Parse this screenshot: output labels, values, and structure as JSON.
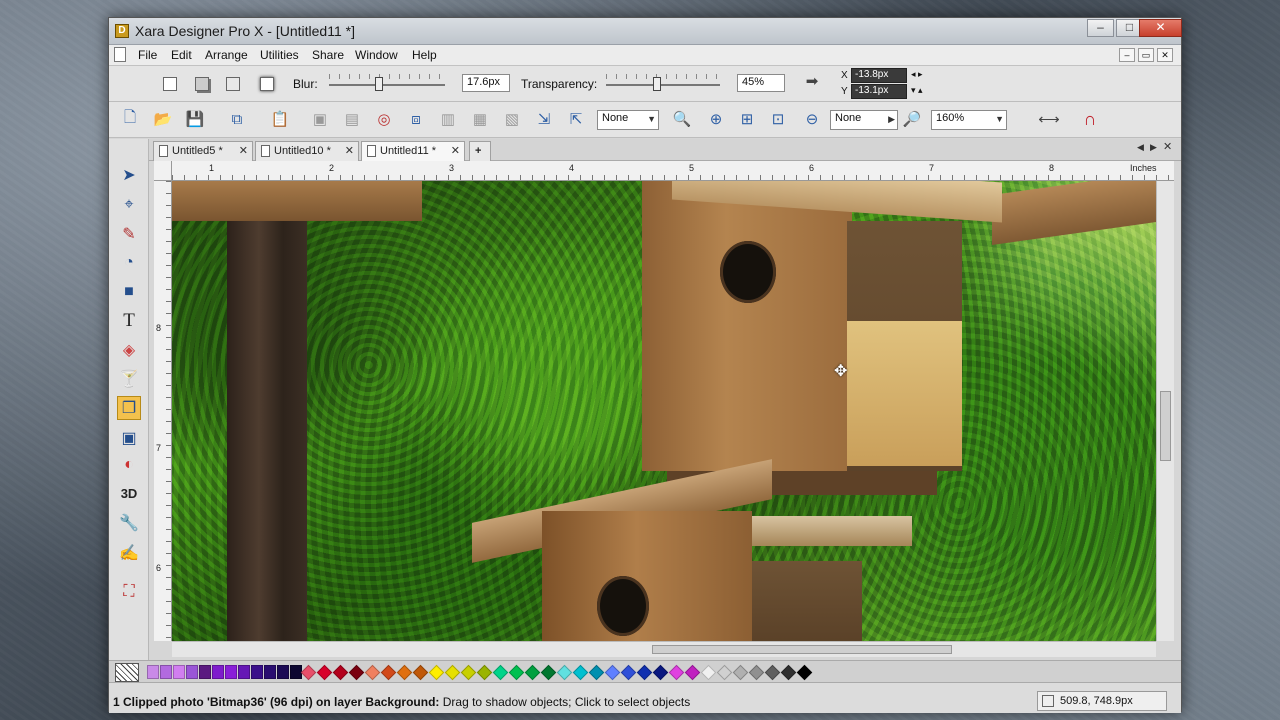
{
  "window": {
    "title": "Xara Designer Pro X - [Untitled11 *]"
  },
  "menu": [
    "File",
    "Edit",
    "Arrange",
    "Utilities",
    "Share",
    "Window",
    "Help"
  ],
  "infobar": {
    "blur_label": "Blur:",
    "blur_value": "17.6px",
    "transparency_label": "Transparency:",
    "transparency_value": "45%",
    "x_label": "X",
    "x_value": "-13.8px",
    "y_label": "Y",
    "y_value": "-13.1px"
  },
  "toolbar": {
    "feather_select": "None",
    "zoom_select": "None",
    "zoom_level": "160%"
  },
  "tabs": [
    {
      "label": "Untitled5 *",
      "active": false
    },
    {
      "label": "Untitled10 *",
      "active": false
    },
    {
      "label": "Untitled11 *",
      "active": true
    }
  ],
  "ruler": {
    "top_labels": [
      "1",
      "2",
      "3",
      "4",
      "5",
      "6",
      "7",
      "8"
    ],
    "unit": "Inches",
    "left_labels": [
      "8",
      "7",
      "6"
    ]
  },
  "palette_colors": [
    "#c98ae8",
    "#b26ae0",
    "#d17ef0",
    "#9a55d6",
    "#5b1a80",
    "#7f1ccc",
    "#8a1fd8",
    "#6618b5",
    "#3a0f8a",
    "#2a0d70",
    "#1c0a55",
    "#0c0630",
    "#e84f6a",
    "#d8002a",
    "#b3001c",
    "#7a0010",
    "#f08060",
    "#d24a1a",
    "#e07010",
    "#c05808",
    "#ffee00",
    "#e6e000",
    "#c8d000",
    "#9ab400",
    "#00d48a",
    "#00c050",
    "#00a040",
    "#007830",
    "#60e0e0",
    "#00c0d0",
    "#0090b0",
    "#6080ff",
    "#3050d8",
    "#1030b0",
    "#0a1880",
    "#e040e0",
    "#c020c0",
    "#f0f0f0",
    "#d0d0d0",
    "#b0b0b0",
    "#909090",
    "#606060",
    "#303030",
    "#000000"
  ],
  "status": {
    "message": "1 Clipped photo 'Bitmap36' (96 dpi) on layer Background: Drag to shadow objects; Click to select objects",
    "coords": "509.8, 748.9px"
  }
}
